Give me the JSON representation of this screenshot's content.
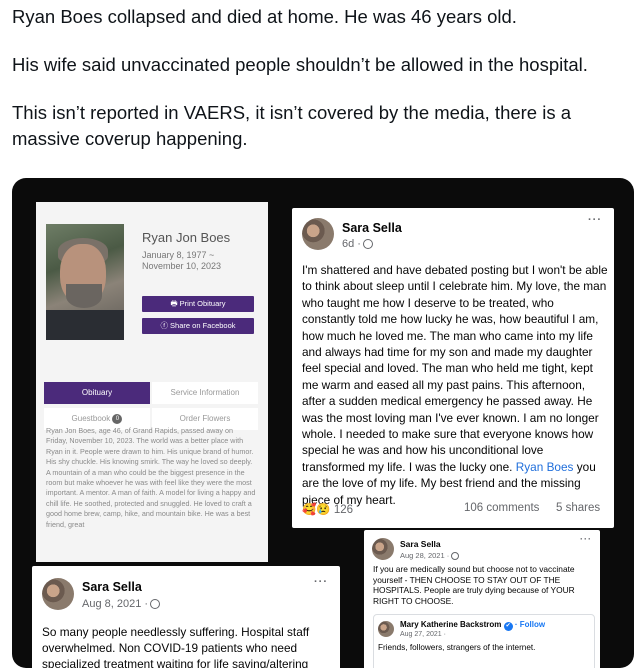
{
  "tweet": {
    "line1": "Ryan Boes collapsed and died at home. He was 46 years old.",
    "line2": "His wife said unvaccinated people shouldn’t be allowed in the hospital.",
    "line3": "This isn’t reported in VAERS, it isn’t covered by the media, there is a massive coverup happening."
  },
  "obituary": {
    "name": "Ryan Jon Boes",
    "dates": "January 8, 1977 ~ November 10, 2023",
    "print_button": "🖶 Print Obituary",
    "share_button": "ⓕ Share on Facebook",
    "tabs": [
      "Obituary",
      "Service Information",
      "Guestbook",
      "Order Flowers"
    ],
    "guestbook_count": "0",
    "body": "Ryan Jon Boes, age 46, of Grand Rapids, passed away on Friday, November 10, 2023. The world was a better place with Ryan in it. People were drawn to him. His unique brand of humor. His shy chuckle. His knowing smirk. The way he loved so deeply. A mountain of a man who could be the biggest presence in the room but make whoever he was with feel like they were the most important. A mentor. A man of faith. A model for living a happy and chill life. He soothed, protected and snuggled. He loved to craft a good home brew, camp, hike, and mountain bike. He was a best friend, great"
  },
  "post_main": {
    "author": "Sara Sella",
    "meta": "6d ·",
    "body_before": "I'm shattered and have debated posting but I won't be able to think about sleep until I celebrate him. My love, the man who taught me how I deserve to be treated, who constantly told me how lucky he was, how beautiful I am, how much he loved me. The man who came into my life and always had time for my son and made my daughter feel special and loved. The man who held me tight, kept me warm and eased all my past pains. This afternoon, after a sudden medical emergency he passed away. He was the most loving man I've ever known. I am no longer whole. I needed to make sure that everyone knows how special he was and how his unconditional love transformed my life. I was the lucky one. ",
    "body_link": "Ryan Boes",
    "body_after": " you are the love of my life. My best friend and the missing piece of my heart.",
    "reactions_emoji": "🥰😢",
    "reactions_count": "126",
    "comments": "106 comments",
    "shares": "5 shares",
    "more": "···"
  },
  "post_small": {
    "author": "Sara Sella",
    "meta": "Aug 28, 2021 ·",
    "body": "If you are medically sound but choose not to vaccinate yourself - THEN CHOOSE TO STAY OUT OF THE HOSPITALS. People are truly dying because of YOUR RIGHT TO CHOOSE.",
    "more": "···",
    "shared_author": "Mary Katherine Backstrom",
    "shared_verified": "✔",
    "shared_follow": "· Follow",
    "shared_meta": "Aug 27, 2021 ·",
    "shared_body": "Friends, followers, strangers of the internet."
  },
  "post_bottom": {
    "author": "Sara Sella",
    "meta": "Aug 8, 2021 ·",
    "body": "So many people needlessly suffering. Hospital staff overwhelmed. Non COVID-19 patients who need specialized treatment waiting for life saving/altering",
    "more": "···"
  },
  "colors": {
    "obit_purple": "#4b2a7b",
    "fb_link": "#216fdb",
    "media_bg": "#0b0b0b"
  }
}
